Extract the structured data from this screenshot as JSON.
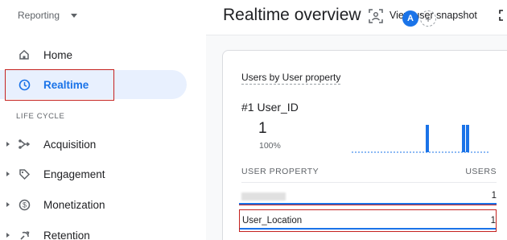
{
  "sidebar": {
    "property_label": "Reporting",
    "section_label": "LIFE CYCLE",
    "items": [
      {
        "label": "Home",
        "icon": "home-icon"
      },
      {
        "label": "Realtime",
        "icon": "clock-icon",
        "active": true
      },
      {
        "label": "Acquisition",
        "icon": "acquisition-icon"
      },
      {
        "label": "Engagement",
        "icon": "tag-icon"
      },
      {
        "label": "Monetization",
        "icon": "dollar-icon"
      },
      {
        "label": "Retention",
        "icon": "retention-icon"
      }
    ]
  },
  "header": {
    "title": "Realtime overview",
    "avatar_letter": "A",
    "plus_symbol": "+",
    "snapshot_label": "View user snapshot"
  },
  "card": {
    "title": "Users by User property",
    "rank_line": "#1  User_ID",
    "value": "1",
    "percent": "100%",
    "table": {
      "columns": [
        "USER PROPERTY",
        "USERS"
      ],
      "rows": [
        {
          "name": "",
          "value": "1",
          "redacted": true,
          "share": 1.0
        },
        {
          "name": "User_Location",
          "value": "1",
          "share": 1.0
        }
      ]
    }
  },
  "colors": {
    "accent": "#1a73e8",
    "active_bg": "#e8f0fe",
    "highlight_box": "#c5221f"
  }
}
